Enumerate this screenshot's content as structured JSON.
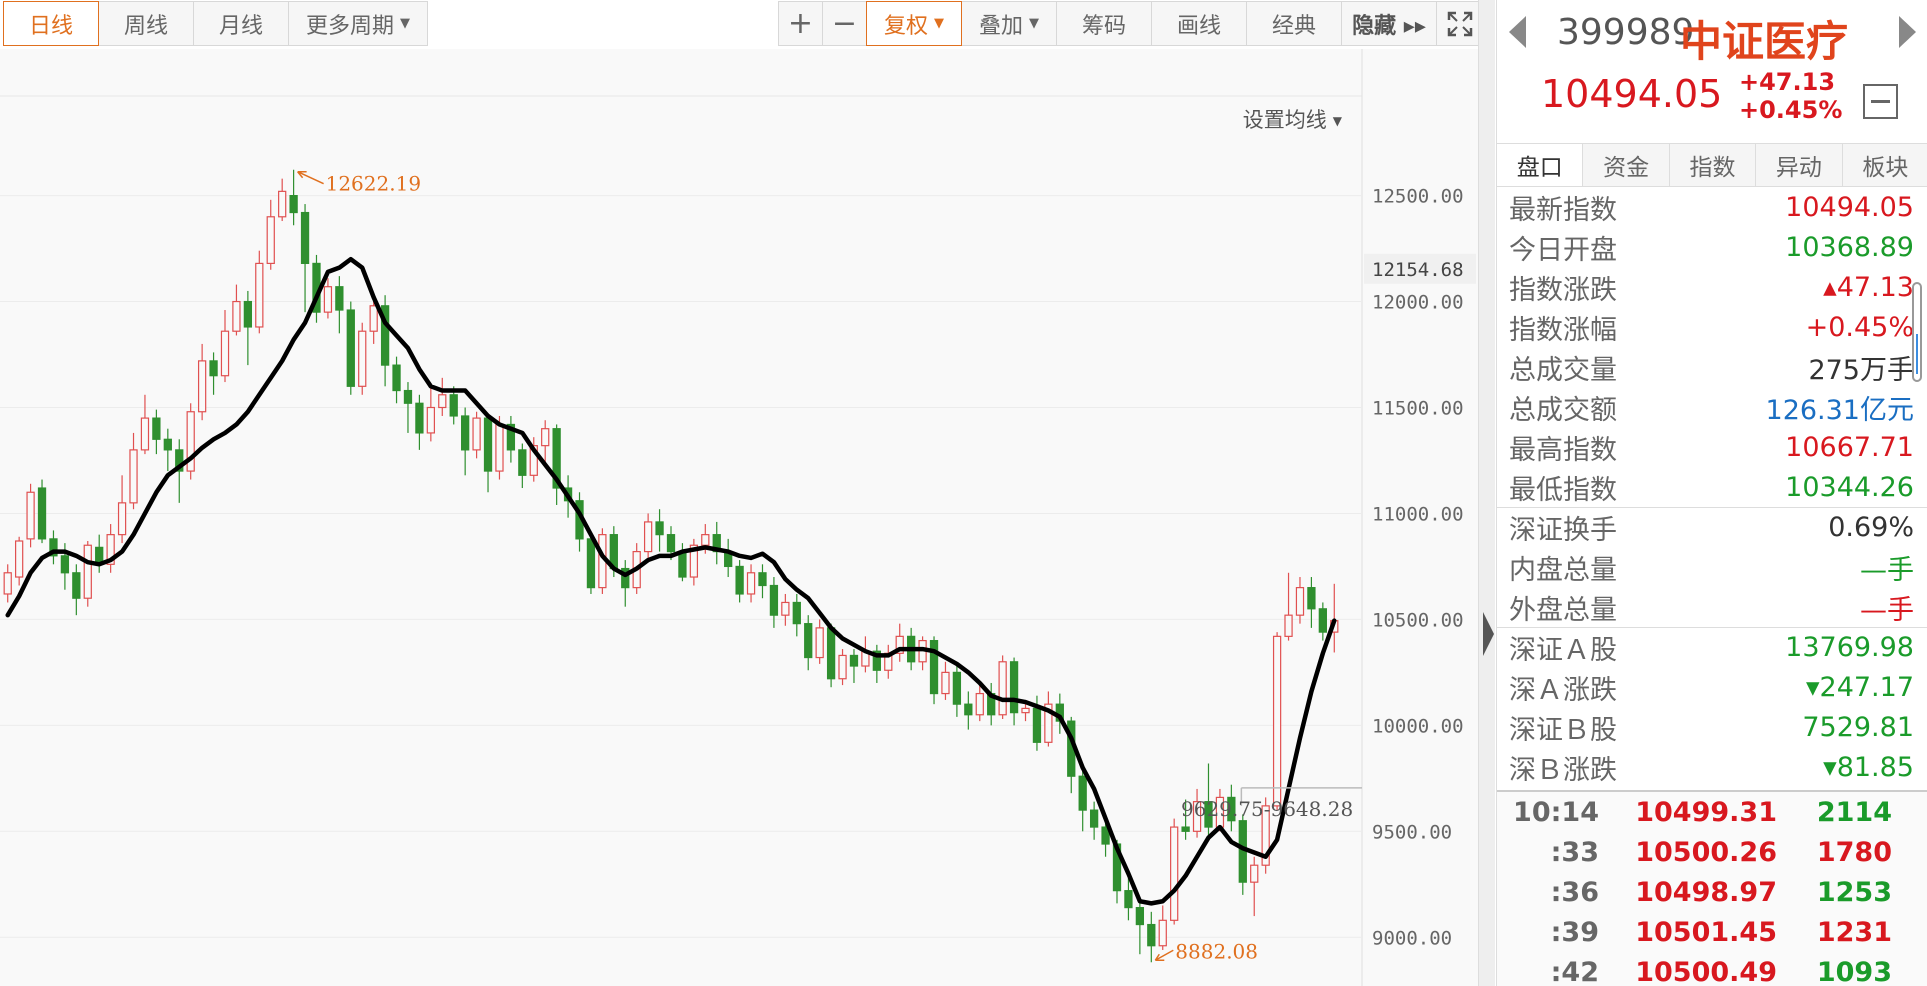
{
  "toolbar": {
    "left_tabs": [
      "日线",
      "周线",
      "月线",
      "更多周期"
    ],
    "zoom_in": "+",
    "zoom_out": "−",
    "fuquan": "复权",
    "overlay": "叠加",
    "chips": "筹码",
    "draw": "画线",
    "classic": "经典",
    "hide": "隐藏 ▸▸",
    "fullscreen_icon": "fullscreen-icon"
  },
  "ma_setting": "设置均线",
  "panel": {
    "code": "399989",
    "name": "中证医疗",
    "price": "10494.05",
    "change": "+47.13",
    "change_pct": "+0.45%",
    "tabs": [
      "盘口",
      "资金",
      "指数",
      "异动",
      "板块"
    ],
    "stats": [
      {
        "label": "最新指数",
        "value": "10494.05",
        "color": "red"
      },
      {
        "label": "今日开盘",
        "value": "10368.89",
        "color": "green"
      },
      {
        "label": "指数涨跌",
        "value": "▴47.13",
        "color": "red"
      },
      {
        "label": "指数涨幅",
        "value": "+0.45%",
        "color": "red"
      },
      {
        "label": "总成交量",
        "value": "275万手",
        "color": "dark"
      },
      {
        "label": "总成交额",
        "value": "126.31亿元",
        "color": "blue"
      },
      {
        "label": "最高指数",
        "value": "10667.71",
        "color": "red"
      },
      {
        "label": "最低指数",
        "value": "10344.26",
        "color": "green"
      }
    ],
    "stats2": [
      {
        "label": "深证换手",
        "value": "0.69%",
        "color": "dark"
      },
      {
        "label": "内盘总量",
        "value": "—手",
        "color": "green"
      },
      {
        "label": "外盘总量",
        "value": "—手",
        "color": "red"
      }
    ],
    "stats3": [
      {
        "label": "深证Ａ股",
        "value": "13769.98",
        "color": "green"
      },
      {
        "label": "深Ａ涨跌",
        "value": "▾247.17",
        "color": "green"
      },
      {
        "label": "深证Ｂ股",
        "value": "7529.81",
        "color": "green"
      },
      {
        "label": "深Ｂ涨跌",
        "value": "▾81.85",
        "color": "green"
      }
    ],
    "ticks": [
      {
        "time": "10:14",
        "price": "10499.31",
        "vol": "2114",
        "color": "green"
      },
      {
        "time": ":33",
        "price": "10500.26",
        "vol": "1780",
        "color": "red"
      },
      {
        "time": ":36",
        "price": "10498.97",
        "vol": "1253",
        "color": "green"
      },
      {
        "time": ":39",
        "price": "10501.45",
        "vol": "1231",
        "color": "red"
      },
      {
        "time": ":42",
        "price": "10500.49",
        "vol": "1093",
        "color": "green"
      }
    ]
  },
  "chart_data": {
    "type": "candlestick",
    "y_ticks": [
      "12500.00",
      "12000.00",
      "11500.00",
      "11000.00",
      "10500.00",
      "10000.00",
      "9500.00",
      "9000.00"
    ],
    "ylim": [
      8770,
      12970
    ],
    "crosshair_label": "12154.68",
    "crosshair_value": 12154.68,
    "range_label": "9629.75-9648.28",
    "range_value": 9648.28,
    "max_label": "12622.19",
    "min_label": "8882.08",
    "up_color": "#e05050",
    "down_color": "#2f8f2f",
    "ma_color": "#000000",
    "candles": [
      [
        10620,
        10720,
        10580,
        10760
      ],
      [
        10700,
        10870,
        10660,
        10890
      ],
      [
        10880,
        11100,
        10840,
        11140
      ],
      [
        11120,
        10880,
        10860,
        11160
      ],
      [
        10880,
        10800,
        10760,
        10920
      ],
      [
        10800,
        10720,
        10640,
        10860
      ],
      [
        10720,
        10600,
        10520,
        10760
      ],
      [
        10600,
        10850,
        10560,
        10870
      ],
      [
        10840,
        10760,
        10720,
        10900
      ],
      [
        10760,
        10900,
        10720,
        10950
      ],
      [
        10900,
        11050,
        10860,
        11180
      ],
      [
        11050,
        11300,
        11020,
        11380
      ],
      [
        11300,
        11450,
        11280,
        11560
      ],
      [
        11450,
        11350,
        11280,
        11490
      ],
      [
        11350,
        11300,
        11200,
        11400
      ],
      [
        11300,
        11200,
        11050,
        11350
      ],
      [
        11200,
        11480,
        11160,
        11520
      ],
      [
        11480,
        11720,
        11440,
        11800
      ],
      [
        11720,
        11650,
        11560,
        11760
      ],
      [
        11650,
        11860,
        11620,
        11960
      ],
      [
        11860,
        12000,
        11840,
        12080
      ],
      [
        12000,
        11880,
        11700,
        12050
      ],
      [
        11880,
        12180,
        11850,
        12240
      ],
      [
        12180,
        12400,
        12150,
        12480
      ],
      [
        12400,
        12520,
        12380,
        12580
      ],
      [
        12500,
        12420,
        12360,
        12622
      ],
      [
        12420,
        12180,
        11950,
        12460
      ],
      [
        12180,
        11950,
        11900,
        12220
      ],
      [
        11950,
        12070,
        11920,
        12110
      ],
      [
        12070,
        11960,
        11850,
        12120
      ],
      [
        11960,
        11600,
        11560,
        12000
      ],
      [
        11600,
        11860,
        11560,
        11900
      ],
      [
        11860,
        11980,
        11800,
        12020
      ],
      [
        11980,
        11700,
        11600,
        12030
      ],
      [
        11700,
        11580,
        11520,
        11740
      ],
      [
        11580,
        11520,
        11380,
        11620
      ],
      [
        11520,
        11380,
        11300,
        11560
      ],
      [
        11380,
        11500,
        11340,
        11600
      ],
      [
        11500,
        11560,
        11460,
        11640
      ],
      [
        11560,
        11460,
        11420,
        11600
      ],
      [
        11460,
        11300,
        11180,
        11500
      ],
      [
        11300,
        11450,
        11260,
        11480
      ],
      [
        11450,
        11200,
        11100,
        11470
      ],
      [
        11200,
        11420,
        11160,
        11460
      ],
      [
        11420,
        11300,
        11240,
        11460
      ],
      [
        11300,
        11180,
        11120,
        11330
      ],
      [
        11180,
        11320,
        11150,
        11360
      ],
      [
        11320,
        11400,
        11240,
        11440
      ],
      [
        11400,
        11120,
        11040,
        11420
      ],
      [
        11120,
        11060,
        10980,
        11180
      ],
      [
        11060,
        10880,
        10820,
        11100
      ],
      [
        10880,
        10650,
        10620,
        10900
      ],
      [
        10650,
        10900,
        10620,
        10930
      ],
      [
        10900,
        10740,
        10700,
        10940
      ],
      [
        10740,
        10650,
        10560,
        10780
      ],
      [
        10650,
        10820,
        10620,
        10860
      ],
      [
        10820,
        10960,
        10780,
        11000
      ],
      [
        10960,
        10900,
        10820,
        11020
      ],
      [
        10900,
        10820,
        10780,
        10940
      ],
      [
        10820,
        10700,
        10680,
        10860
      ],
      [
        10700,
        10850,
        10660,
        10880
      ],
      [
        10850,
        10900,
        10810,
        10950
      ],
      [
        10900,
        10820,
        10760,
        10960
      ],
      [
        10820,
        10750,
        10700,
        10880
      ],
      [
        10750,
        10620,
        10580,
        10780
      ],
      [
        10620,
        10720,
        10580,
        10760
      ],
      [
        10720,
        10660,
        10600,
        10760
      ],
      [
        10660,
        10520,
        10460,
        10700
      ],
      [
        10520,
        10580,
        10470,
        10620
      ],
      [
        10580,
        10480,
        10420,
        10620
      ],
      [
        10480,
        10320,
        10260,
        10520
      ],
      [
        10320,
        10460,
        10290,
        10500
      ],
      [
        10460,
        10220,
        10180,
        10480
      ],
      [
        10220,
        10330,
        10190,
        10360
      ],
      [
        10330,
        10280,
        10200,
        10360
      ],
      [
        10280,
        10350,
        10250,
        10420
      ],
      [
        10350,
        10260,
        10200,
        10380
      ],
      [
        10260,
        10340,
        10220,
        10380
      ],
      [
        10340,
        10420,
        10300,
        10480
      ],
      [
        10420,
        10300,
        10260,
        10460
      ],
      [
        10300,
        10400,
        10260,
        10420
      ],
      [
        10400,
        10150,
        10100,
        10420
      ],
      [
        10150,
        10250,
        10120,
        10300
      ],
      [
        10250,
        10100,
        10040,
        10280
      ],
      [
        10100,
        10050,
        9980,
        10160
      ],
      [
        10050,
        10150,
        10020,
        10200
      ],
      [
        10150,
        10050,
        10000,
        10200
      ],
      [
        10050,
        10300,
        10030,
        10330
      ],
      [
        10300,
        10060,
        10000,
        10320
      ],
      [
        10060,
        10080,
        10020,
        10120
      ],
      [
        10080,
        9920,
        9880,
        10140
      ],
      [
        9920,
        10100,
        9900,
        10160
      ],
      [
        10100,
        10020,
        9960,
        10150
      ],
      [
        10020,
        9760,
        9680,
        10040
      ],
      [
        9760,
        9600,
        9500,
        9800
      ],
      [
        9600,
        9520,
        9460,
        9640
      ],
      [
        9520,
        9440,
        9380,
        9560
      ],
      [
        9440,
        9220,
        9160,
        9460
      ],
      [
        9220,
        9140,
        9080,
        9280
      ],
      [
        9140,
        9060,
        8920,
        9180
      ],
      [
        9060,
        8960,
        8882,
        9120
      ],
      [
        8960,
        9080,
        8940,
        9150
      ],
      [
        9080,
        9520,
        9060,
        9560
      ],
      [
        9520,
        9500,
        9460,
        9650
      ],
      [
        9500,
        9640,
        9470,
        9700
      ],
      [
        9640,
        9520,
        9460,
        9820
      ],
      [
        9520,
        9660,
        9500,
        9700
      ],
      [
        9660,
        9550,
        9500,
        9720
      ],
      [
        9550,
        9260,
        9200,
        9580
      ],
      [
        9260,
        9340,
        9100,
        9380
      ],
      [
        9340,
        9620,
        9300,
        9660
      ],
      [
        9620,
        10420,
        9600,
        10440
      ],
      [
        10420,
        10520,
        10400,
        10720
      ],
      [
        10520,
        10650,
        10480,
        10700
      ],
      [
        10650,
        10550,
        10460,
        10700
      ],
      [
        10550,
        10440,
        10400,
        10580
      ],
      [
        10440,
        10494,
        10344,
        10668
      ]
    ],
    "ma": [
      10520,
      10610,
      10720,
      10790,
      10820,
      10820,
      10800,
      10770,
      10760,
      10780,
      10820,
      10900,
      11000,
      11100,
      11180,
      11220,
      11260,
      11310,
      11350,
      11380,
      11420,
      11480,
      11560,
      11640,
      11720,
      11820,
      11900,
      12020,
      12140,
      12160,
      12200,
      12160,
      12020,
      11900,
      11840,
      11780,
      11680,
      11600,
      11580,
      11580,
      11580,
      11520,
      11460,
      11420,
      11400,
      11380,
      11300,
      11230,
      11160,
      11080,
      11000,
      10900,
      10800,
      10740,
      10710,
      10740,
      10780,
      10800,
      10800,
      10820,
      10830,
      10840,
      10830,
      10820,
      10800,
      10790,
      10810,
      10770,
      10690,
      10640,
      10600,
      10530,
      10460,
      10410,
      10380,
      10350,
      10330,
      10330,
      10360,
      10360,
      10360,
      10350,
      10320,
      10290,
      10250,
      10200,
      10140,
      10120,
      10120,
      10110,
      10090,
      10070,
      10040,
      9940,
      9800,
      9700,
      9560,
      9420,
      9300,
      9170,
      9160,
      9170,
      9220,
      9290,
      9380,
      9470,
      9520,
      9450,
      9420,
      9400,
      9380,
      9460,
      9700,
      9940,
      10160,
      10340,
      10494
    ]
  }
}
